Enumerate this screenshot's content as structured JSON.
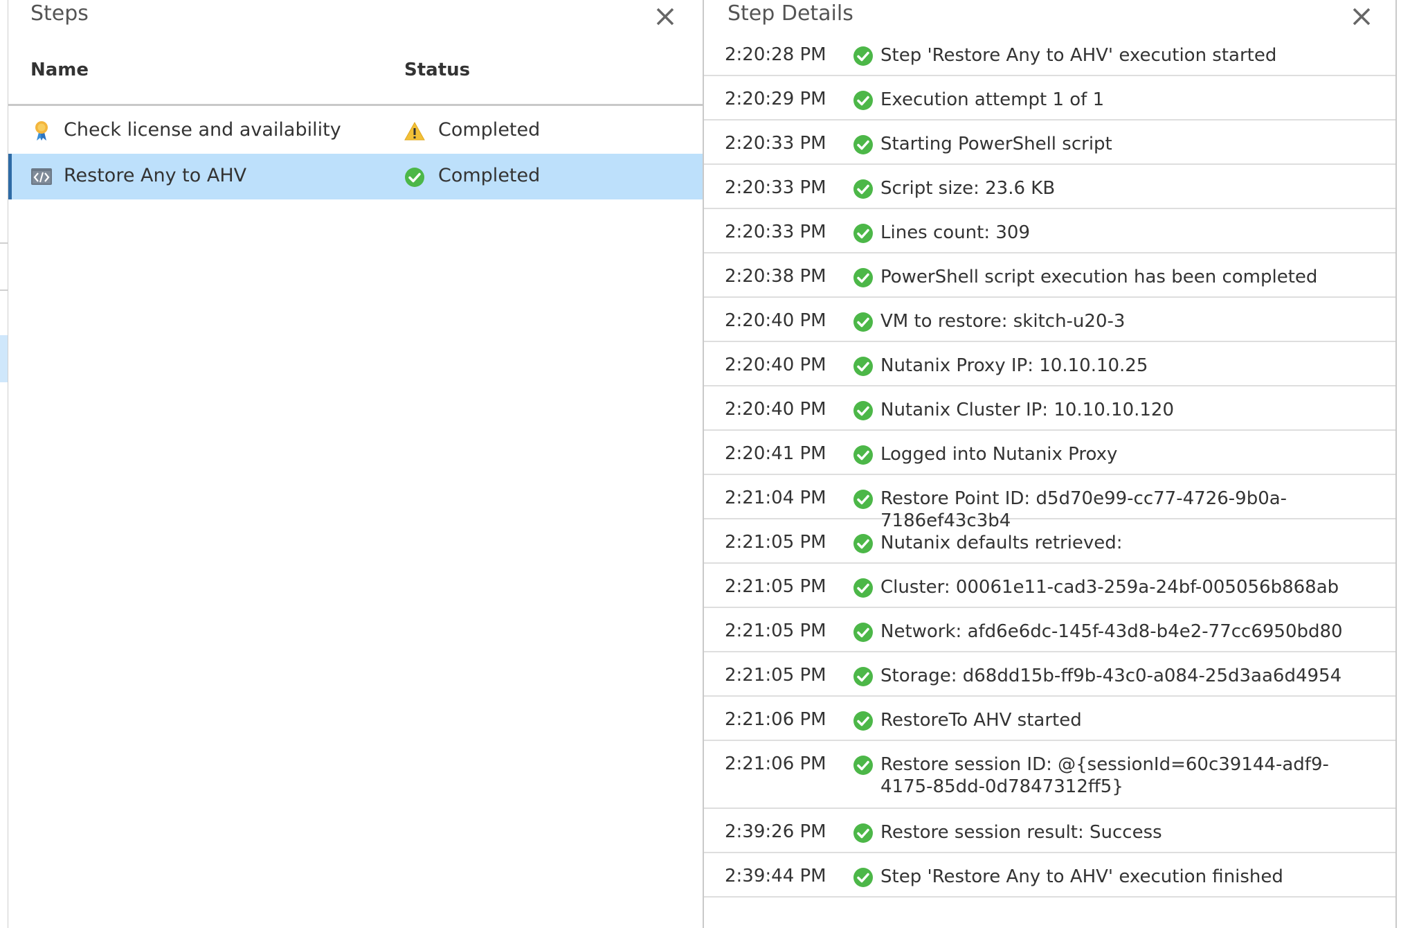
{
  "steps_panel": {
    "title": "Steps",
    "close_icon": "close-icon",
    "columns": {
      "name": "Name",
      "status": "Status"
    },
    "rows": [
      {
        "name": "Check license and availability",
        "status": "Completed",
        "icon": "license-icon",
        "status_icon": "warning-icon",
        "selected": false
      },
      {
        "name": "Restore Any to AHV",
        "status": "Completed",
        "icon": "script-icon",
        "status_icon": "success-check-icon",
        "selected": true
      }
    ]
  },
  "details_panel": {
    "title": "Step Details",
    "close_icon": "close-icon",
    "entries": [
      {
        "time": "2:20:28 PM",
        "message": "Step 'Restore Any to AHV' execution started"
      },
      {
        "time": "2:20:29 PM",
        "message": "Execution attempt 1 of 1"
      },
      {
        "time": "2:20:33 PM",
        "message": "Starting PowerShell script"
      },
      {
        "time": "2:20:33 PM",
        "message": "Script size: 23.6 KB"
      },
      {
        "time": "2:20:33 PM",
        "message": "Lines count: 309"
      },
      {
        "time": "2:20:38 PM",
        "message": "PowerShell script execution has been completed"
      },
      {
        "time": "2:20:40 PM",
        "message": "VM to restore: skitch-u20-3"
      },
      {
        "time": "2:20:40 PM",
        "message": "Nutanix Proxy IP: 10.10.10.25"
      },
      {
        "time": "2:20:40 PM",
        "message": "Nutanix Cluster IP: 10.10.10.120"
      },
      {
        "time": "2:20:41 PM",
        "message": "Logged into Nutanix Proxy"
      },
      {
        "time": "2:21:04 PM",
        "message": "Restore Point ID: d5d70e99-cc77-4726-9b0a-7186ef43c3b4"
      },
      {
        "time": "2:21:05 PM",
        "message": "Nutanix defaults retrieved:"
      },
      {
        "time": "2:21:05 PM",
        "message": "Cluster: 00061e11-cad3-259a-24bf-005056b868ab"
      },
      {
        "time": "2:21:05 PM",
        "message": "Network: afd6e6dc-145f-43d8-b4e2-77cc6950bd80"
      },
      {
        "time": "2:21:05 PM",
        "message": "Storage: d68dd15b-ff9b-43c0-a084-25d3aa6d4954"
      },
      {
        "time": "2:21:06 PM",
        "message": "RestoreTo AHV started"
      },
      {
        "time": "2:21:06 PM",
        "message": "Restore session ID: @{sessionId=60c39144-adf9-4175-85dd-0d7847312ff5}"
      },
      {
        "time": "2:39:26 PM",
        "message": "Restore session result: Success"
      },
      {
        "time": "2:39:44 PM",
        "message": "Step 'Restore Any to AHV' execution finished"
      }
    ]
  },
  "colors": {
    "selected_row": "#bde0fb",
    "selection_bar": "#2e6ba6",
    "success_green": "#4cb748",
    "warning_yellow": "#f2c037"
  }
}
